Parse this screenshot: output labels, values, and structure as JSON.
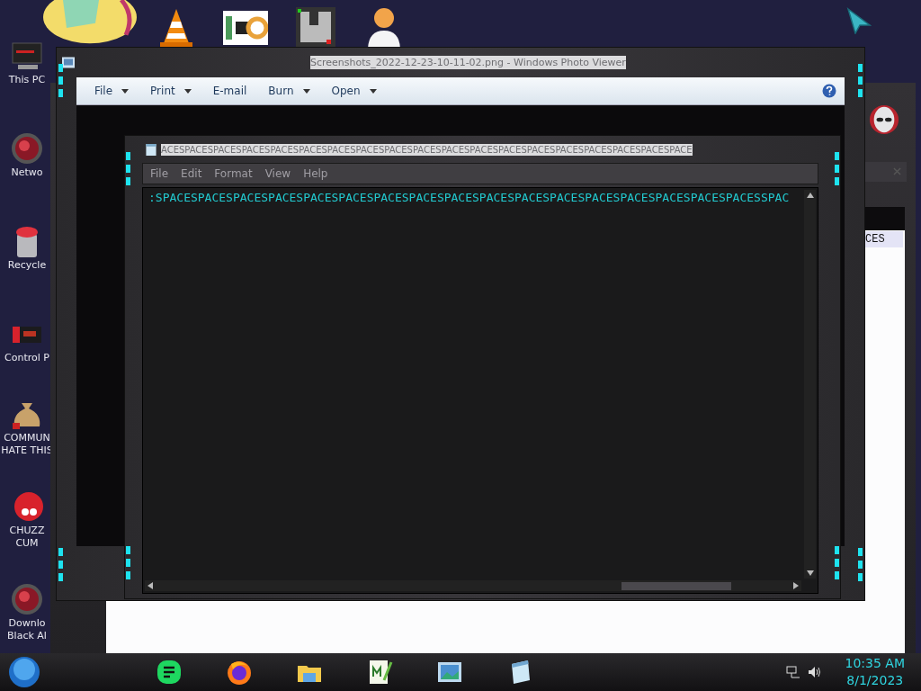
{
  "desktop_icons": [
    {
      "lines": [
        "This PC"
      ]
    },
    {
      "lines": [
        "Netwo"
      ]
    },
    {
      "lines": [
        "Recycle"
      ]
    },
    {
      "lines": [
        "Control P"
      ]
    },
    {
      "lines": [
        "COMMUN",
        "HATE THIS"
      ]
    },
    {
      "lines": [
        "CHUZZ",
        "CUM"
      ]
    },
    {
      "lines": [
        "Downlo",
        "Black Al"
      ]
    }
  ],
  "back_window": {
    "row_text": "CES"
  },
  "photo_viewer": {
    "title": "Screenshots_2022-12-23-10-11-02.png - Windows Photo Viewer",
    "toolbar": [
      {
        "label": "File",
        "dropdown": true
      },
      {
        "label": "Print",
        "dropdown": true
      },
      {
        "label": "E-mail",
        "dropdown": false
      },
      {
        "label": "Burn",
        "dropdown": true
      },
      {
        "label": "Open",
        "dropdown": true
      }
    ]
  },
  "notepad": {
    "title": "ACESPACESPACESPACESPACESPACESPACESPACESPACESPACESPACESPACESPACESPACESPACESPACESPACESPACESPACE",
    "menu": [
      "File",
      "Edit",
      "Format",
      "View",
      "Help"
    ],
    "text": ":SPACESPACESPACESPACESPACESPACESPACESPACESPACESPACESPACESPACESPACESPACESPACESPACESPACESSPAC"
  },
  "taskbar": {
    "time": "10:35 AM",
    "date": "8/1/2023"
  }
}
